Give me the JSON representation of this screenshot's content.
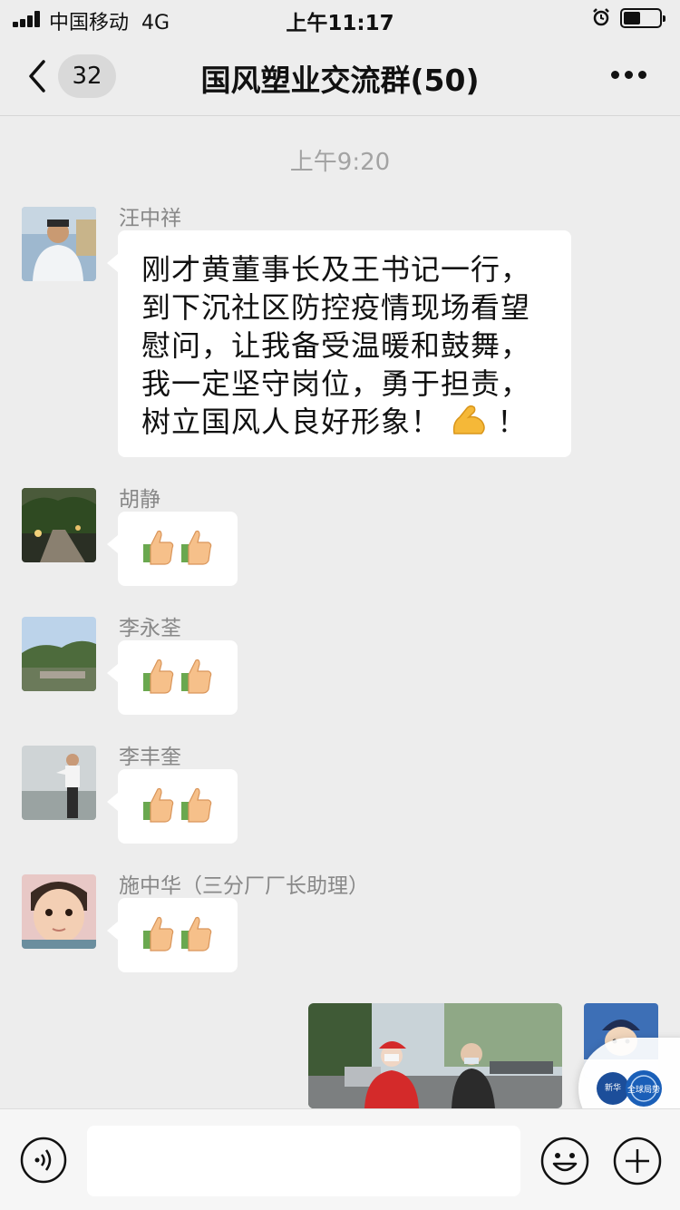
{
  "status_bar": {
    "carrier": "中国移动",
    "network": "4G",
    "time": "上午11:17"
  },
  "nav": {
    "unread_count": "32",
    "title": "国风塑业交流群(50)"
  },
  "chat": {
    "timestamp": "上午9:20",
    "messages": [
      {
        "sender": "汪中祥",
        "text": "刚才黄董事长及王书记一行，到下沉社区防控疫情现场看望慰问，让我备受温暖和鼓舞，我一定坚守岗位，勇于担责，树立国风人良好形象！",
        "emoji": "flexed-biceps",
        "text_after_emoji": "！"
      },
      {
        "sender": "胡静",
        "emojis": [
          "thumbs-up",
          "thumbs-up"
        ]
      },
      {
        "sender": "李永荃",
        "emojis": [
          "thumbs-up",
          "thumbs-up"
        ]
      },
      {
        "sender": "李丰奎",
        "emojis": [
          "thumbs-up",
          "thumbs-up"
        ]
      },
      {
        "sender": "施中华（三分厂厂长助理）",
        "emojis": [
          "thumbs-up",
          "thumbs-up"
        ]
      }
    ],
    "float_widget_text": [
      "新华",
      "全球局势"
    ]
  },
  "input_bar": {
    "text_value": ""
  },
  "colors": {
    "background": "#ededed",
    "bubble": "#ffffff",
    "muted_text": "#888888"
  }
}
